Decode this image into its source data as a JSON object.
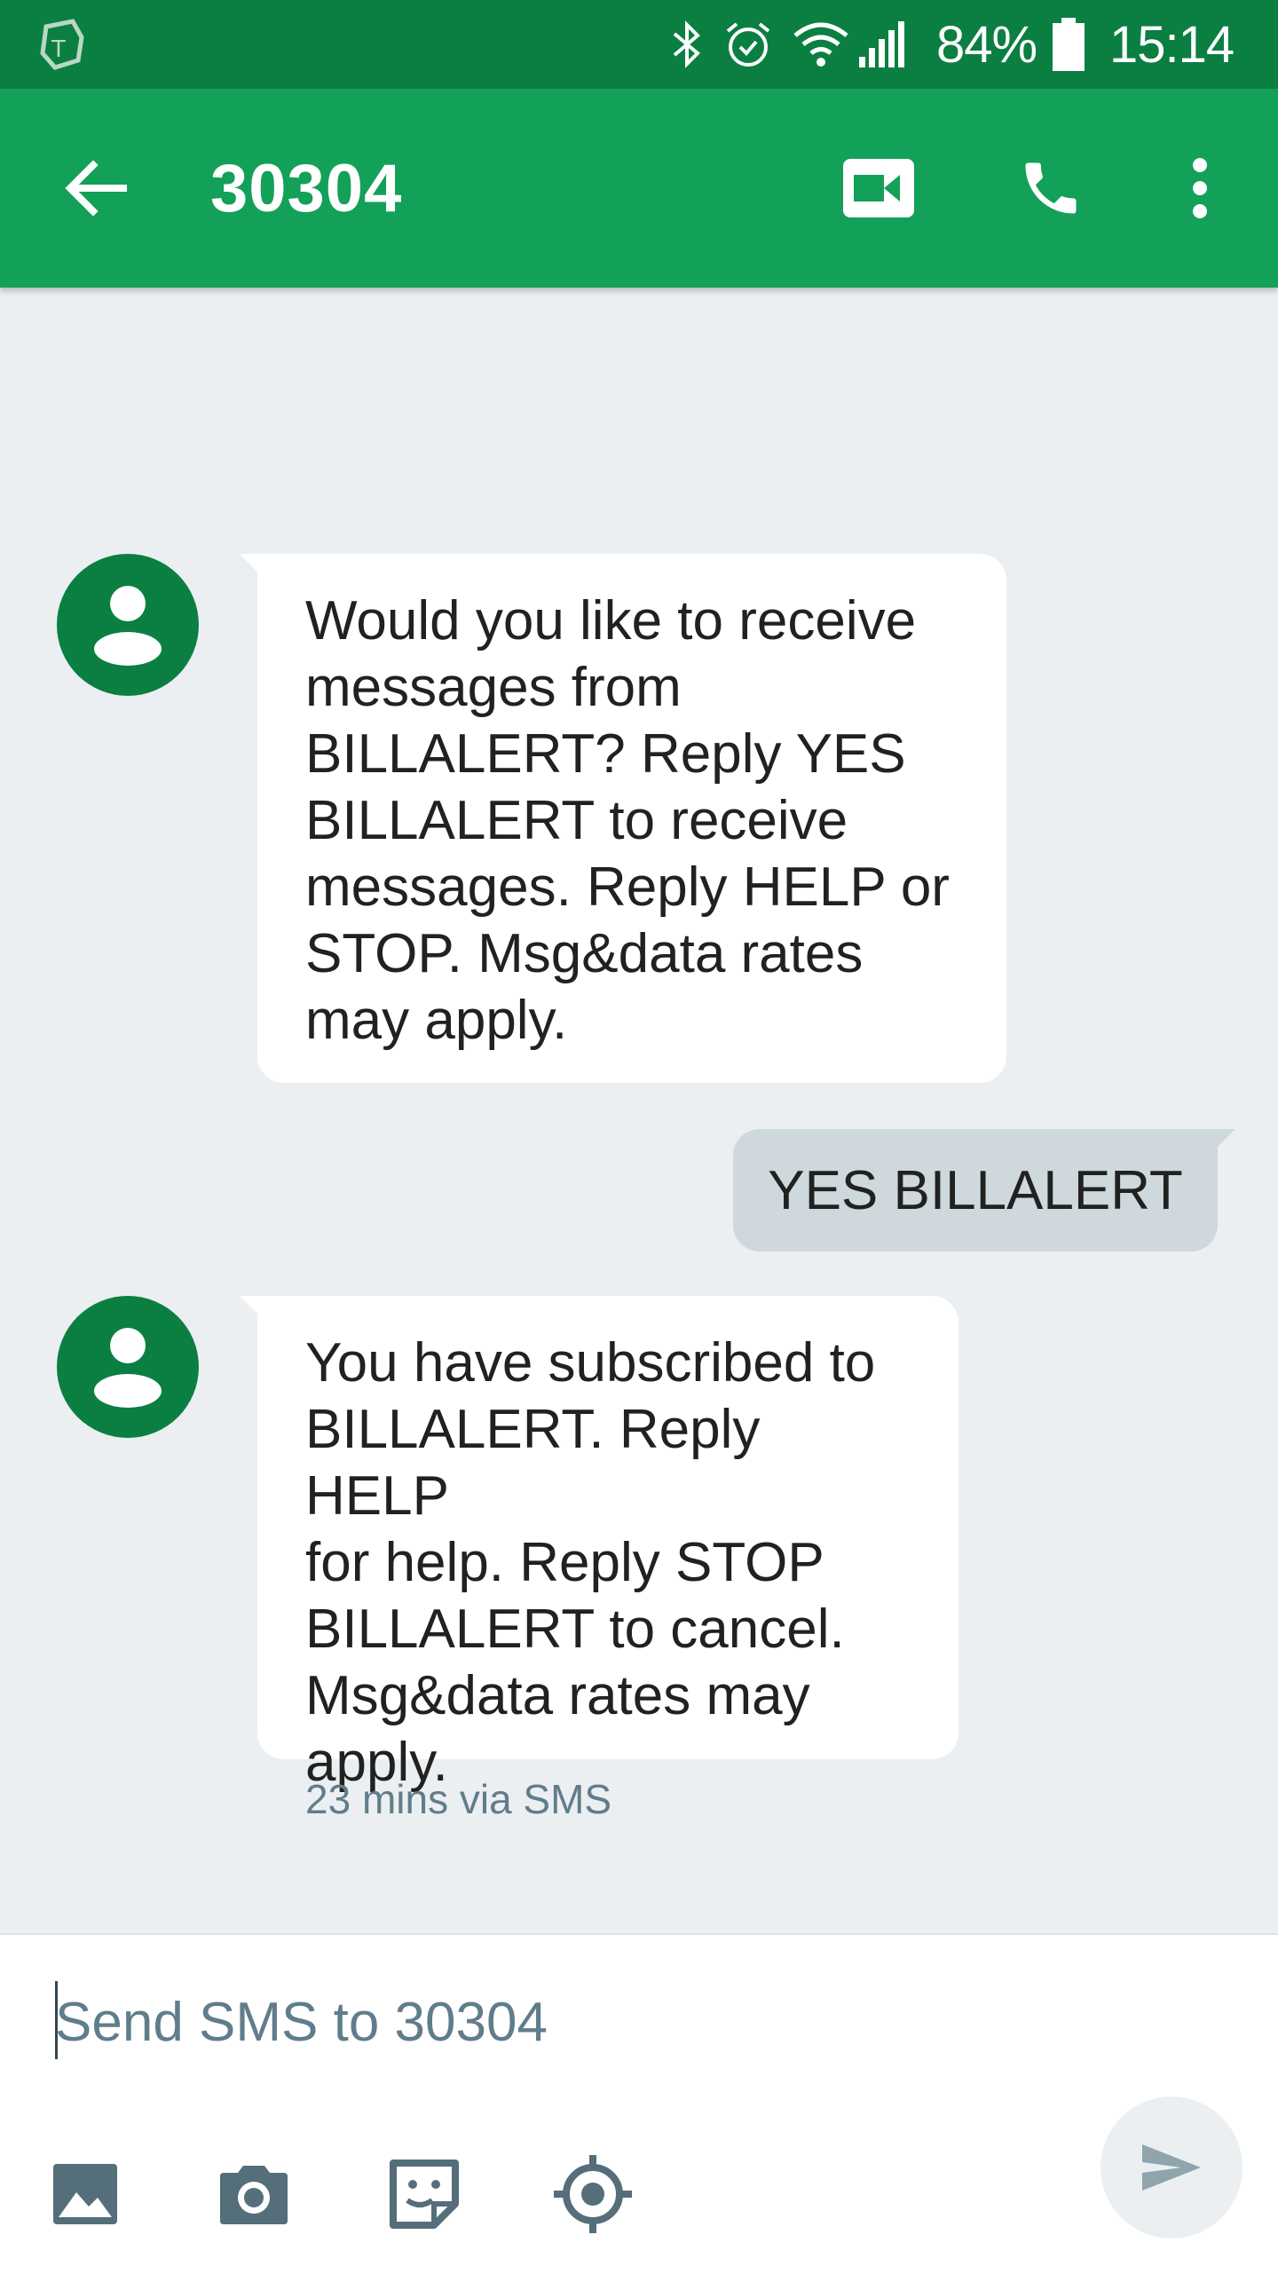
{
  "status_bar": {
    "battery_percent": "84%",
    "time": "15:14",
    "icons": [
      "carrier-logo-icon",
      "bluetooth-icon",
      "alarm-icon",
      "wifi-icon",
      "signal-icon",
      "battery-icon"
    ]
  },
  "app_bar": {
    "title": "30304",
    "icons": [
      "back-arrow-icon",
      "video-call-icon",
      "phone-icon",
      "more-vert-icon"
    ]
  },
  "messages": [
    {
      "direction": "incoming",
      "lines": [
        "Would you like to receive",
        "messages from",
        "BILLALERT? Reply YES",
        "BILLALERT to receive",
        "messages. Reply HELP or",
        "STOP. Msg&data rates",
        "may apply."
      ]
    },
    {
      "direction": "outgoing",
      "lines": [
        "YES BILLALERT"
      ]
    },
    {
      "direction": "incoming",
      "lines": [
        "You have subscribed to",
        "BILLALERT. Reply HELP",
        "for help. Reply STOP",
        "BILLALERT to cancel.",
        "Msg&data rates may",
        "apply."
      ],
      "timestamp": "23 mins via SMS"
    }
  ],
  "compose": {
    "placeholder": "Send SMS to 30304",
    "tools": [
      "image-icon",
      "camera-icon",
      "sticker-icon",
      "location-icon"
    ],
    "send_icon": "send-icon"
  },
  "colors": {
    "status_bar": "#0b7f42",
    "app_bar": "#13a058",
    "background": "#eceff1",
    "incoming_bubble": "#ffffff",
    "outgoing_bubble": "#cfd8dc",
    "avatar": "#0b7f42"
  }
}
